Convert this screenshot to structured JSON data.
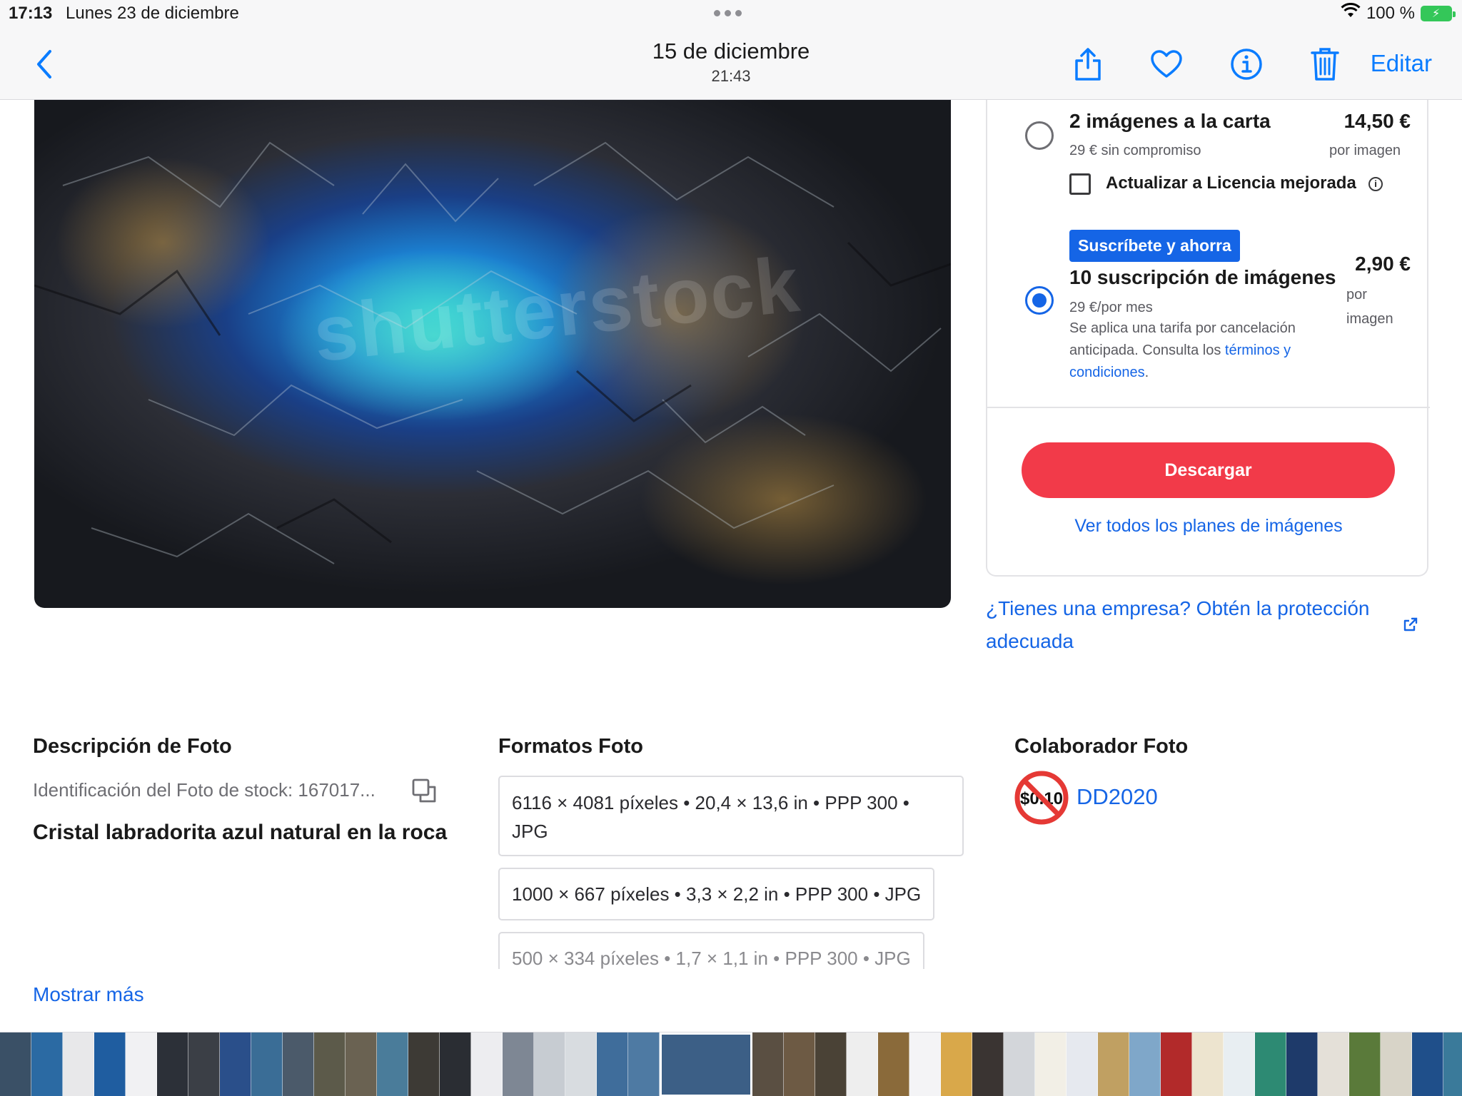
{
  "status_bar": {
    "time": "17:13",
    "date": "Lunes 23 de diciembre",
    "battery": "100 %"
  },
  "nav": {
    "title": "15 de diciembre",
    "subtitle": "21:43",
    "edit_label": "Editar"
  },
  "photo": {
    "watermark": "shutterstock"
  },
  "pricing": {
    "option1": {
      "title": "2 imágenes a la carta",
      "subtitle": "29 € sin compromiso",
      "price": "14,50 €",
      "per": "por imagen",
      "selected": false
    },
    "upgrade_label": "Actualizar a Licencia mejorada",
    "option2": {
      "badge": "Suscríbete y ahorra",
      "title": "10 suscripción de imágenes",
      "subtitle": "29 €/por mes",
      "desc_prefix": "Se aplica una tarifa por cancelación anticipada. Consulta los ",
      "desc_link": "términos y condiciones",
      "desc_suffix": ".",
      "price": "2,90 €",
      "per_line1": "por",
      "per_line2": "imagen",
      "selected": true
    },
    "download_label": "Descargar",
    "all_plans_label": "Ver todos los planes de imágenes"
  },
  "business_link": "¿Tienes una empresa? Obtén la protección adecuada",
  "description": {
    "heading": "Descripción de Foto",
    "stock_id": "Identificación del Foto de stock: 167017...",
    "title": "Cristal labradorita azul natural en la roca"
  },
  "formats": {
    "heading": "Formatos Foto",
    "items": [
      "6116 × 4081 píxeles • 20,4 × 13,6 in • PPP 300 • JPG",
      "1000 × 667 píxeles • 3,3 × 2,2 in • PPP 300 • JPG",
      "500 × 334 píxeles • 1,7 × 1,1 in • PPP 300 • JPG"
    ]
  },
  "contributor": {
    "heading": "Colaborador Foto",
    "avatar_text": "$0.10",
    "name": "DD2020"
  },
  "show_more": "Mostrar más",
  "colors": {
    "accent": "#1565e6",
    "ios_blue": "#0a7cff",
    "download": "#f23a49"
  },
  "icons": [
    "back-chevron-icon",
    "share-icon",
    "heart-icon",
    "info-icon",
    "trash-icon",
    "wifi-icon",
    "battery-icon",
    "external-link-icon",
    "copy-icon"
  ]
}
